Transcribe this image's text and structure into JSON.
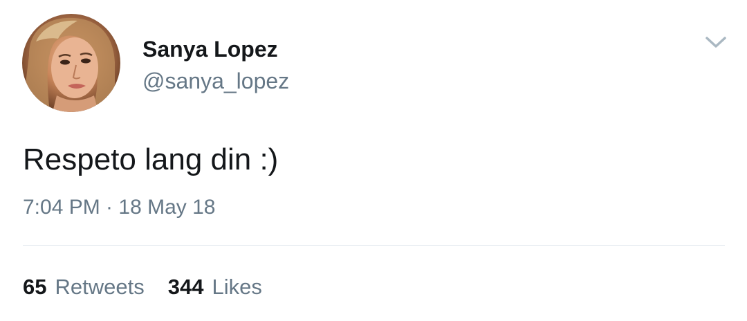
{
  "tweet": {
    "author": {
      "display_name": "Sanya Lopez",
      "handle": "@sanya_lopez",
      "avatar_icon": "profile-photo"
    },
    "text": "Respeto lang din :)",
    "timestamp": "7:04 PM · 18 May 18",
    "menu_icon": "chevron-down-icon",
    "stats": {
      "retweets_count": "65",
      "retweets_label": "Retweets",
      "likes_count": "344",
      "likes_label": "Likes"
    }
  },
  "colors": {
    "primary_text": "#14171a",
    "secondary_text": "#657786",
    "divider": "#e1e8ed",
    "chevron": "#aab8c2"
  }
}
